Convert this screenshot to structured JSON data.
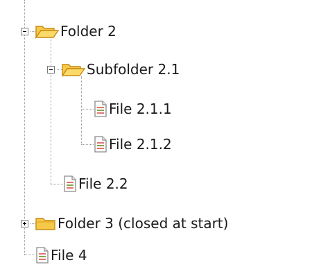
{
  "tree": {
    "folder2": {
      "label": "Folder 2",
      "state": "expanded",
      "icon": "open-folder-icon"
    },
    "subfolder21": {
      "label": "Subfolder 2.1",
      "state": "expanded",
      "icon": "open-folder-icon"
    },
    "file211": {
      "label": "File 2.1.1",
      "icon": "document-icon"
    },
    "file212": {
      "label": "File 2.1.2",
      "icon": "document-icon"
    },
    "file22": {
      "label": "File 2.2",
      "icon": "document-icon"
    },
    "folder3": {
      "label": "Folder 3 (closed at start)",
      "state": "collapsed",
      "icon": "closed-folder-icon"
    },
    "file4": {
      "label": "File 4",
      "icon": "document-icon"
    }
  },
  "colors": {
    "folder_fill": "#f7c948",
    "folder_stroke": "#c88a12",
    "doc_stroke": "#8a8a8a",
    "doc_accent": "#d9534f",
    "connector": "#9a9a9a"
  }
}
